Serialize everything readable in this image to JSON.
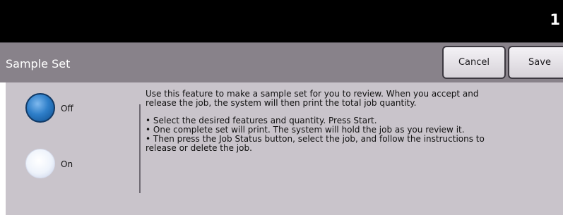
{
  "header": {
    "job_count": "1"
  },
  "titlebar": {
    "title": "Sample Set",
    "cancel_label": "Cancel",
    "save_label": "Save"
  },
  "options": {
    "selected": "Off",
    "off_label": "Off",
    "on_label": "On"
  },
  "description": {
    "intro_1": "Use this feature to make a sample set for you to review.  When you accept and",
    "intro_2": "release the job, the system will then print the total job quantity.",
    "step_1": "• Select the desired features and quantity.  Press Start.",
    "step_2": "• One complete set will print.  The system will hold the job as you review it.",
    "step_3a": "• Then press the Job Status button, select the job, and follow the instructions to",
    "step_3b": "release or delete the job."
  },
  "colors": {
    "header_bg": "#000000",
    "titlebar_bg": "#88828a",
    "panel_bg": "#c9c4cb",
    "radio_selected": "#2f7fc9"
  }
}
